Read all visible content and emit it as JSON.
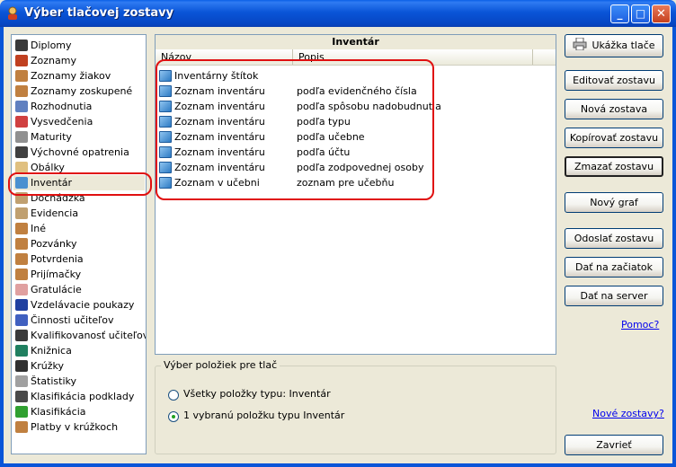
{
  "window": {
    "title": "Výber tlačovej zostavy",
    "min_glyph": "_",
    "max_glyph": "□",
    "close_glyph": "✕"
  },
  "tree": {
    "items": [
      {
        "label": "Diplomy",
        "icon": "people-icon",
        "color": "#3a3a3a"
      },
      {
        "label": "Zoznamy",
        "icon": "house-icon",
        "color": "#c04020"
      },
      {
        "label": "Zoznamy žiakov",
        "icon": "student-icon",
        "color": "#c08040"
      },
      {
        "label": "Zoznamy zoskupené",
        "icon": "student-icon",
        "color": "#c08040"
      },
      {
        "label": "Rozhodnutia",
        "icon": "card-icon",
        "color": "#6080c0"
      },
      {
        "label": "Vysvedčenia",
        "icon": "book-icon",
        "color": "#d04040"
      },
      {
        "label": "Maturity",
        "icon": "trophy-icon",
        "color": "#909090"
      },
      {
        "label": "Výchovné opatrenia",
        "icon": "cap-icon",
        "color": "#404040"
      },
      {
        "label": "Obálky",
        "icon": "envelope-icon",
        "color": "#e0c080"
      },
      {
        "label": "Inventár",
        "icon": "computer-icon",
        "color": "#4a90d0"
      },
      {
        "label": "Dochádzka",
        "icon": "book-icon",
        "color": "#c0a070"
      },
      {
        "label": "Evidencia",
        "icon": "book-icon",
        "color": "#c0a070"
      },
      {
        "label": "Iné",
        "icon": "person-icon",
        "color": "#c08040"
      },
      {
        "label": "Pozvánky",
        "icon": "person-icon",
        "color": "#c08040"
      },
      {
        "label": "Potvrdenia",
        "icon": "person-icon",
        "color": "#c08040"
      },
      {
        "label": "Prijímačky",
        "icon": "person-icon",
        "color": "#c08040"
      },
      {
        "label": "Gratulácie",
        "icon": "cake-icon",
        "color": "#e0a0a0"
      },
      {
        "label": "Vzdelávacie poukazy",
        "icon": "checkmark-icon",
        "color": "#2040a0"
      },
      {
        "label": "Činnosti učiteľov",
        "icon": "checklist-icon",
        "color": "#4060c0"
      },
      {
        "label": "Kvalifikovanosť učiteľov",
        "icon": "people-icon",
        "color": "#3a3a3a"
      },
      {
        "label": "Knižnica",
        "icon": "books-icon",
        "color": "#208060"
      },
      {
        "label": "Krúžky",
        "icon": "football-icon",
        "color": "#303030"
      },
      {
        "label": "Štatistiky",
        "icon": "document-icon",
        "color": "#a0a0a0"
      },
      {
        "label": "Klasifikácia podklady",
        "icon": "people-icon",
        "color": "#4a4a4a"
      },
      {
        "label": "Klasifikácia",
        "icon": "grid-icon",
        "color": "#30a030"
      },
      {
        "label": "Platby v krúžkoch",
        "icon": "person-icon",
        "color": "#c08040"
      }
    ],
    "selected_index": 9
  },
  "list": {
    "title": "Inventár",
    "columns": [
      "Názov",
      "Popis"
    ],
    "rows": [
      {
        "name": "Inventárny štítok",
        "desc": ""
      },
      {
        "name": "Zoznam inventáru",
        "desc": "podľa evidenčného čísla"
      },
      {
        "name": "Zoznam inventáru",
        "desc": "podľa spôsobu nadobudnutia"
      },
      {
        "name": "Zoznam inventáru",
        "desc": "podľa typu"
      },
      {
        "name": "Zoznam inventáru",
        "desc": "podľa učebne"
      },
      {
        "name": "Zoznam inventáru",
        "desc": "podľa účtu"
      },
      {
        "name": "Zoznam inventáru",
        "desc": "podľa zodpovednej osoby"
      },
      {
        "name": "Zoznam v učebni",
        "desc": "zoznam pre učebňu"
      }
    ]
  },
  "selection_group": {
    "legend": "Výber položiek pre tlač",
    "option_all": "Všetky položky typu: Inventár",
    "option_one": "1 vybranú položku typu Inventár",
    "selected": "option_one"
  },
  "buttons": {
    "preview": "Ukážka tlače",
    "edit": "Editovať zostavu",
    "new": "Nová zostava",
    "copy": "Kopírovať zostavu",
    "delete": "Zmazať zostavu",
    "new_graph": "Nový graf",
    "send": "Odoslať zostavu",
    "to_start": "Dať na začiatok",
    "to_server": "Dať na server",
    "close": "Zavrieť"
  },
  "links": {
    "help": "Pomoc?",
    "new_reports": "Nové zostavy?"
  }
}
